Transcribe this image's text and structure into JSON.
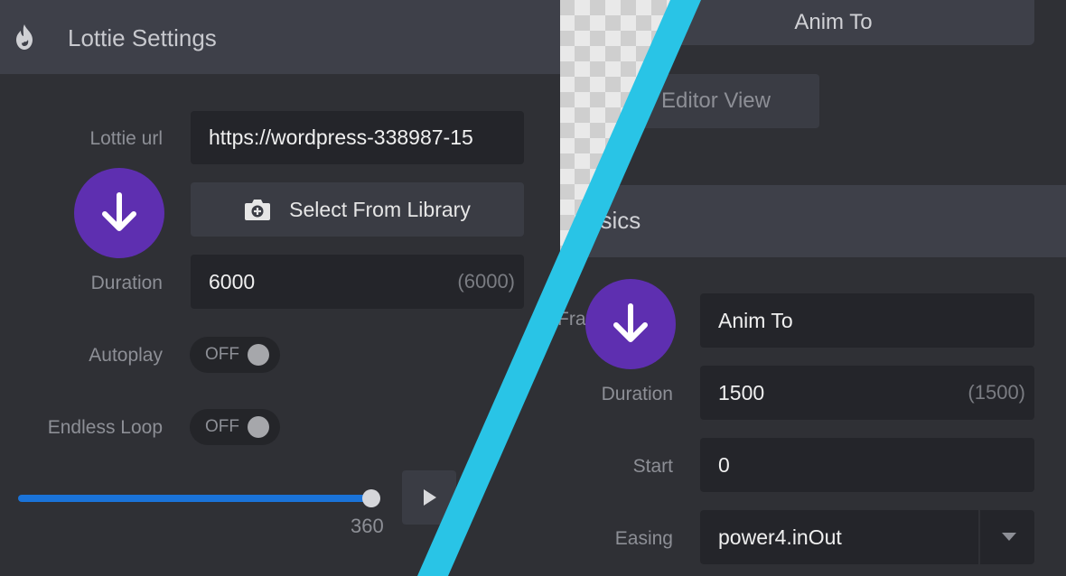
{
  "left_panel": {
    "title": "Lottie Settings",
    "header_icon": "flame-icon",
    "lottie_url_label": "Lottie url",
    "lottie_url_value": "https://wordpress-338987-15",
    "select_library_label": "Select From Library",
    "duration_label": "Duration",
    "duration_value": "6000",
    "duration_hint": "(6000)",
    "autoplay_label": "Autoplay",
    "autoplay_state": "OFF",
    "endless_loop_label": "Endless Loop",
    "endless_loop_state": "OFF",
    "slider_value": "360",
    "slider_fraction": 1.0
  },
  "right_panel": {
    "top_field_value": "Anim To",
    "canvas_editor_label": "as Editor View",
    "section_title": "asics",
    "frame_label_fragment": "Fra",
    "frame_value": "Anim To",
    "duration_label": "Duration",
    "duration_value": "1500",
    "duration_hint": "(1500)",
    "start_label": "Start",
    "start_value": "0",
    "easing_label": "Easing",
    "easing_value": "power4.inOut"
  },
  "overlay": {
    "download_icon": "arrow-down-circle-icon",
    "divider_color": "#29c4e6",
    "badge_color": "#5e2fb0"
  }
}
